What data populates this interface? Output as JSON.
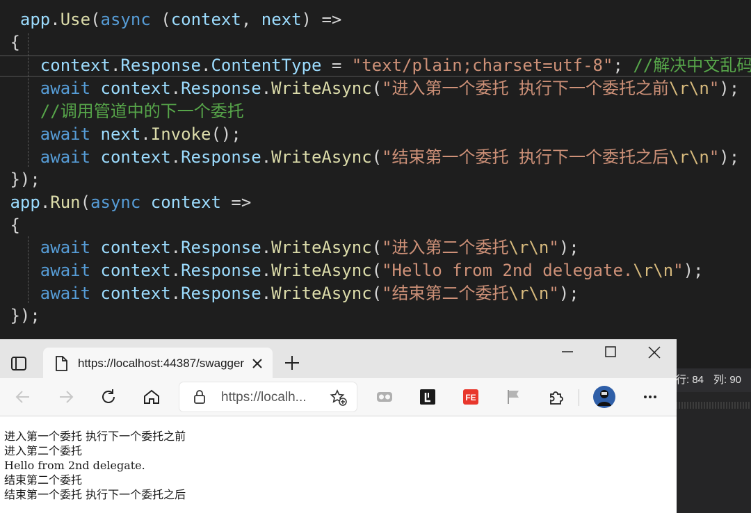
{
  "editor": {
    "lines": [
      {
        "segments": [
          {
            "cls": "pl",
            "t": "  "
          },
          {
            "cls": "var",
            "t": "app"
          },
          {
            "cls": "pl",
            "t": "."
          },
          {
            "cls": "fn",
            "t": "Use"
          },
          {
            "cls": "pl",
            "t": "("
          },
          {
            "cls": "kw",
            "t": "async"
          },
          {
            "cls": "pl",
            "t": " ("
          },
          {
            "cls": "var",
            "t": "context"
          },
          {
            "cls": "pl",
            "t": ", "
          },
          {
            "cls": "var",
            "t": "next"
          },
          {
            "cls": "pl",
            "t": ") =>"
          }
        ]
      },
      {
        "segments": [
          {
            "cls": "pl",
            "t": " {"
          }
        ]
      },
      {
        "segments": [
          {
            "cls": "pl",
            "t": "    "
          },
          {
            "cls": "var",
            "t": "context"
          },
          {
            "cls": "pl",
            "t": "."
          },
          {
            "cls": "var",
            "t": "Response"
          },
          {
            "cls": "pl",
            "t": "."
          },
          {
            "cls": "var",
            "t": "ContentType"
          },
          {
            "cls": "pl",
            "t": " = "
          },
          {
            "cls": "str",
            "t": "\"text/plain;charset=utf-8\""
          },
          {
            "cls": "pl",
            "t": "; "
          },
          {
            "cls": "cm",
            "t": "//解决中文乱码"
          }
        ]
      },
      {
        "segments": [
          {
            "cls": "pl",
            "t": "    "
          },
          {
            "cls": "kw",
            "t": "await"
          },
          {
            "cls": "pl",
            "t": " "
          },
          {
            "cls": "var",
            "t": "context"
          },
          {
            "cls": "pl",
            "t": "."
          },
          {
            "cls": "var",
            "t": "Response"
          },
          {
            "cls": "pl",
            "t": "."
          },
          {
            "cls": "fn",
            "t": "WriteAsync"
          },
          {
            "cls": "pl",
            "t": "("
          },
          {
            "cls": "str",
            "t": "\"进入第一个委托 执行下一个委托之前"
          },
          {
            "cls": "esc",
            "t": "\\r\\n"
          },
          {
            "cls": "str",
            "t": "\""
          },
          {
            "cls": "pl",
            "t": ");"
          }
        ]
      },
      {
        "segments": [
          {
            "cls": "pl",
            "t": "    "
          },
          {
            "cls": "cm",
            "t": "//调用管道中的下一个委托"
          }
        ]
      },
      {
        "segments": [
          {
            "cls": "pl",
            "t": "    "
          },
          {
            "cls": "kw",
            "t": "await"
          },
          {
            "cls": "pl",
            "t": " "
          },
          {
            "cls": "var",
            "t": "next"
          },
          {
            "cls": "pl",
            "t": "."
          },
          {
            "cls": "fn",
            "t": "Invoke"
          },
          {
            "cls": "pl",
            "t": "();"
          }
        ]
      },
      {
        "segments": [
          {
            "cls": "pl",
            "t": "    "
          },
          {
            "cls": "kw",
            "t": "await"
          },
          {
            "cls": "pl",
            "t": " "
          },
          {
            "cls": "var",
            "t": "context"
          },
          {
            "cls": "pl",
            "t": "."
          },
          {
            "cls": "var",
            "t": "Response"
          },
          {
            "cls": "pl",
            "t": "."
          },
          {
            "cls": "fn",
            "t": "WriteAsync"
          },
          {
            "cls": "pl",
            "t": "("
          },
          {
            "cls": "str",
            "t": "\"结束第一个委托 执行下一个委托之后"
          },
          {
            "cls": "esc",
            "t": "\\r\\n"
          },
          {
            "cls": "str",
            "t": "\""
          },
          {
            "cls": "pl",
            "t": ");"
          }
        ]
      },
      {
        "segments": [
          {
            "cls": "pl",
            "t": " });"
          }
        ]
      },
      {
        "segments": [
          {
            "cls": "pl",
            "t": " "
          },
          {
            "cls": "var",
            "t": "app"
          },
          {
            "cls": "pl",
            "t": "."
          },
          {
            "cls": "fn",
            "t": "Run"
          },
          {
            "cls": "pl",
            "t": "("
          },
          {
            "cls": "kw",
            "t": "async"
          },
          {
            "cls": "pl",
            "t": " "
          },
          {
            "cls": "var",
            "t": "context"
          },
          {
            "cls": "pl",
            "t": " =>"
          }
        ]
      },
      {
        "segments": [
          {
            "cls": "pl",
            "t": " {"
          }
        ]
      },
      {
        "segments": [
          {
            "cls": "pl",
            "t": "    "
          },
          {
            "cls": "kw",
            "t": "await"
          },
          {
            "cls": "pl",
            "t": " "
          },
          {
            "cls": "var",
            "t": "context"
          },
          {
            "cls": "pl",
            "t": "."
          },
          {
            "cls": "var",
            "t": "Response"
          },
          {
            "cls": "pl",
            "t": "."
          },
          {
            "cls": "fn",
            "t": "WriteAsync"
          },
          {
            "cls": "pl",
            "t": "("
          },
          {
            "cls": "str",
            "t": "\"进入第二个委托"
          },
          {
            "cls": "esc",
            "t": "\\r\\n"
          },
          {
            "cls": "str",
            "t": "\""
          },
          {
            "cls": "pl",
            "t": ");"
          }
        ]
      },
      {
        "segments": [
          {
            "cls": "pl",
            "t": "    "
          },
          {
            "cls": "kw",
            "t": "await"
          },
          {
            "cls": "pl",
            "t": " "
          },
          {
            "cls": "var",
            "t": "context"
          },
          {
            "cls": "pl",
            "t": "."
          },
          {
            "cls": "var",
            "t": "Response"
          },
          {
            "cls": "pl",
            "t": "."
          },
          {
            "cls": "fn",
            "t": "WriteAsync"
          },
          {
            "cls": "pl",
            "t": "("
          },
          {
            "cls": "str",
            "t": "\"Hello from 2nd delegate."
          },
          {
            "cls": "esc",
            "t": "\\r\\n"
          },
          {
            "cls": "str",
            "t": "\""
          },
          {
            "cls": "pl",
            "t": ");"
          }
        ]
      },
      {
        "segments": [
          {
            "cls": "pl",
            "t": "    "
          },
          {
            "cls": "kw",
            "t": "await"
          },
          {
            "cls": "pl",
            "t": " "
          },
          {
            "cls": "var",
            "t": "context"
          },
          {
            "cls": "pl",
            "t": "."
          },
          {
            "cls": "var",
            "t": "Response"
          },
          {
            "cls": "pl",
            "t": "."
          },
          {
            "cls": "fn",
            "t": "WriteAsync"
          },
          {
            "cls": "pl",
            "t": "("
          },
          {
            "cls": "str",
            "t": "\"结束第二个委托"
          },
          {
            "cls": "esc",
            "t": "\\r\\n"
          },
          {
            "cls": "str",
            "t": "\""
          },
          {
            "cls": "pl",
            "t": ");"
          }
        ]
      },
      {
        "segments": [
          {
            "cls": "pl",
            "t": " });"
          }
        ]
      }
    ]
  },
  "status": {
    "line_label": "行: 84",
    "col_label": "列: 90"
  },
  "browser": {
    "tab_title": "https://localhost:44387/swagger",
    "address": "https://localh...",
    "output_lines": [
      "进入第一个委托 执行下一个委托之前",
      "进入第二个委托",
      "Hello from 2nd delegate.",
      "结束第二个委托",
      "结束第一个委托 执行下一个委托之后"
    ],
    "toolbar_icons": [
      "back-icon",
      "forward-icon",
      "refresh-icon",
      "home-icon",
      "favorites-add-icon",
      "immersive-reader-icon",
      "extension-l-icon",
      "extension-fe-icon",
      "flag-icon",
      "extensions-puzzle-icon",
      "profile-avatar",
      "more-menu-icon"
    ]
  },
  "colors": {
    "editor_bg": "#1e1e1e",
    "keyword": "#569cd6",
    "identifier": "#9cdcfe",
    "method": "#dcdcaa",
    "string": "#ce9178",
    "comment": "#57a64a"
  }
}
